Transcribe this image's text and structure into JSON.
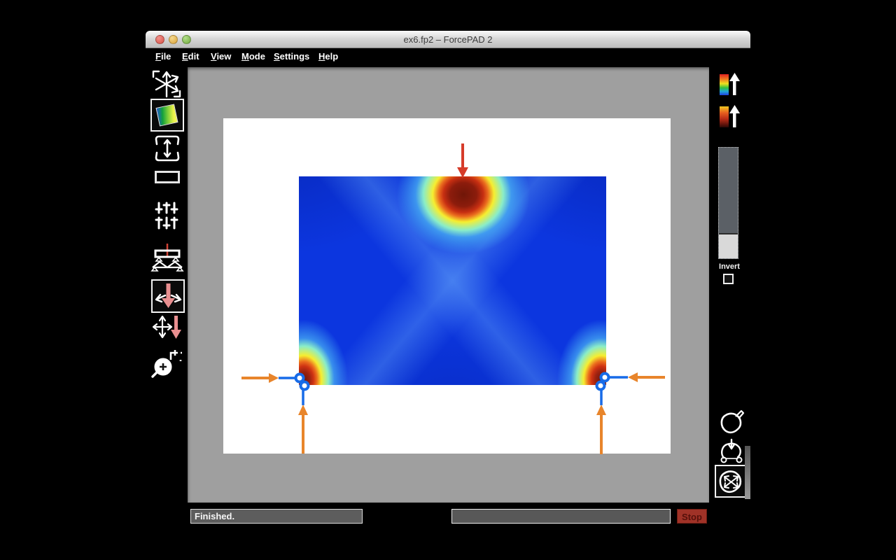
{
  "window": {
    "title": "ex6.fp2 – ForcePAD 2",
    "traffic_lights": [
      "close",
      "minimize",
      "zoom"
    ]
  },
  "menu": {
    "items": [
      {
        "accel": "F",
        "rest": "ile"
      },
      {
        "accel": "E",
        "rest": "dit"
      },
      {
        "accel": "V",
        "rest": "iew"
      },
      {
        "accel": "M",
        "rest": "ode"
      },
      {
        "accel": "S",
        "rest": "ettings"
      },
      {
        "accel": "H",
        "rest": "elp"
      }
    ]
  },
  "left_toolbar": {
    "tools": [
      {
        "name": "pan-arrows",
        "selected": false
      },
      {
        "name": "stress-colormap-view",
        "selected": true
      },
      {
        "name": "displacement-view",
        "selected": false
      },
      {
        "name": "draw-rectangle",
        "selected": false
      },
      {
        "name": "adjust-sliders",
        "selected": false
      },
      {
        "name": "structure-load",
        "selected": false
      },
      {
        "name": "force-direction",
        "selected": true
      },
      {
        "name": "move-force",
        "selected": false
      },
      {
        "name": "zoom-region",
        "selected": false
      }
    ]
  },
  "right_toolbar": {
    "tools": [
      {
        "name": "colormap-rainbow",
        "selected": false
      },
      {
        "name": "colormap-red",
        "selected": false
      },
      {
        "name": "draw-blob",
        "selected": false
      },
      {
        "name": "blob-load-supports",
        "selected": false
      },
      {
        "name": "blob-forces",
        "selected": true
      }
    ],
    "slider": {
      "name": "colormap-level-slider",
      "handle_position": "bottom"
    },
    "invert_label": "Invert",
    "invert_checked": false
  },
  "statusbar": {
    "status_text": "Finished.",
    "progress_value": "",
    "stop_label": "Stop"
  },
  "visualization": {
    "type": "2d-stress-field",
    "hot_spots": [
      "top-center load point",
      "bottom-left corner",
      "bottom-right corner"
    ],
    "load_arrows": [
      "red downward force at top center",
      "orange rightward force at bottom-left corner",
      "orange leftward force at bottom-right corner",
      "orange upward forces under both bottom corners"
    ],
    "supports": [
      "blue roller constraint at bottom-left corner",
      "blue roller constraint at bottom-right corner"
    ]
  },
  "colors": {
    "accent_orange": "#e8852b",
    "accent_blue": "#176be8",
    "accent_red": "#d63c2a",
    "canvas_gray": "#9f9f9f",
    "stop_red": "#a03227",
    "field_blue": "#0c36df"
  }
}
